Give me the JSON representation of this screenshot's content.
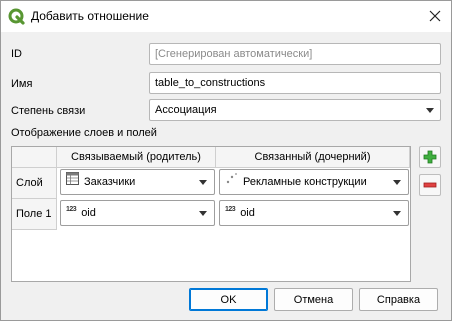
{
  "window": {
    "title": "Добавить отношение"
  },
  "form": {
    "id_label": "ID",
    "id_placeholder": "[Сгенерирован автоматически]",
    "name_label": "Имя",
    "name_value": "table_to_constructions",
    "strength_label": "Степень связи",
    "strength_value": "Ассоциация",
    "mapping_label": "Отображение слоев и полей"
  },
  "grid": {
    "col_parent": "Связываемый (родитель)",
    "col_child": "Связанный (дочерний)",
    "row_layer": "Слой",
    "row_field": "Поле 1",
    "parent_layer": "Заказчики",
    "child_layer": "Рекламные конструкции",
    "parent_field": "oid",
    "child_field": "oid",
    "field_type_glyph": "123"
  },
  "buttons": {
    "ok": "OK",
    "cancel": "Отмена",
    "help": "Справка"
  },
  "colors": {
    "accent": "#0078d7",
    "add": "#2e9e2e",
    "remove": "#d4302f",
    "qgis": "#589632"
  }
}
